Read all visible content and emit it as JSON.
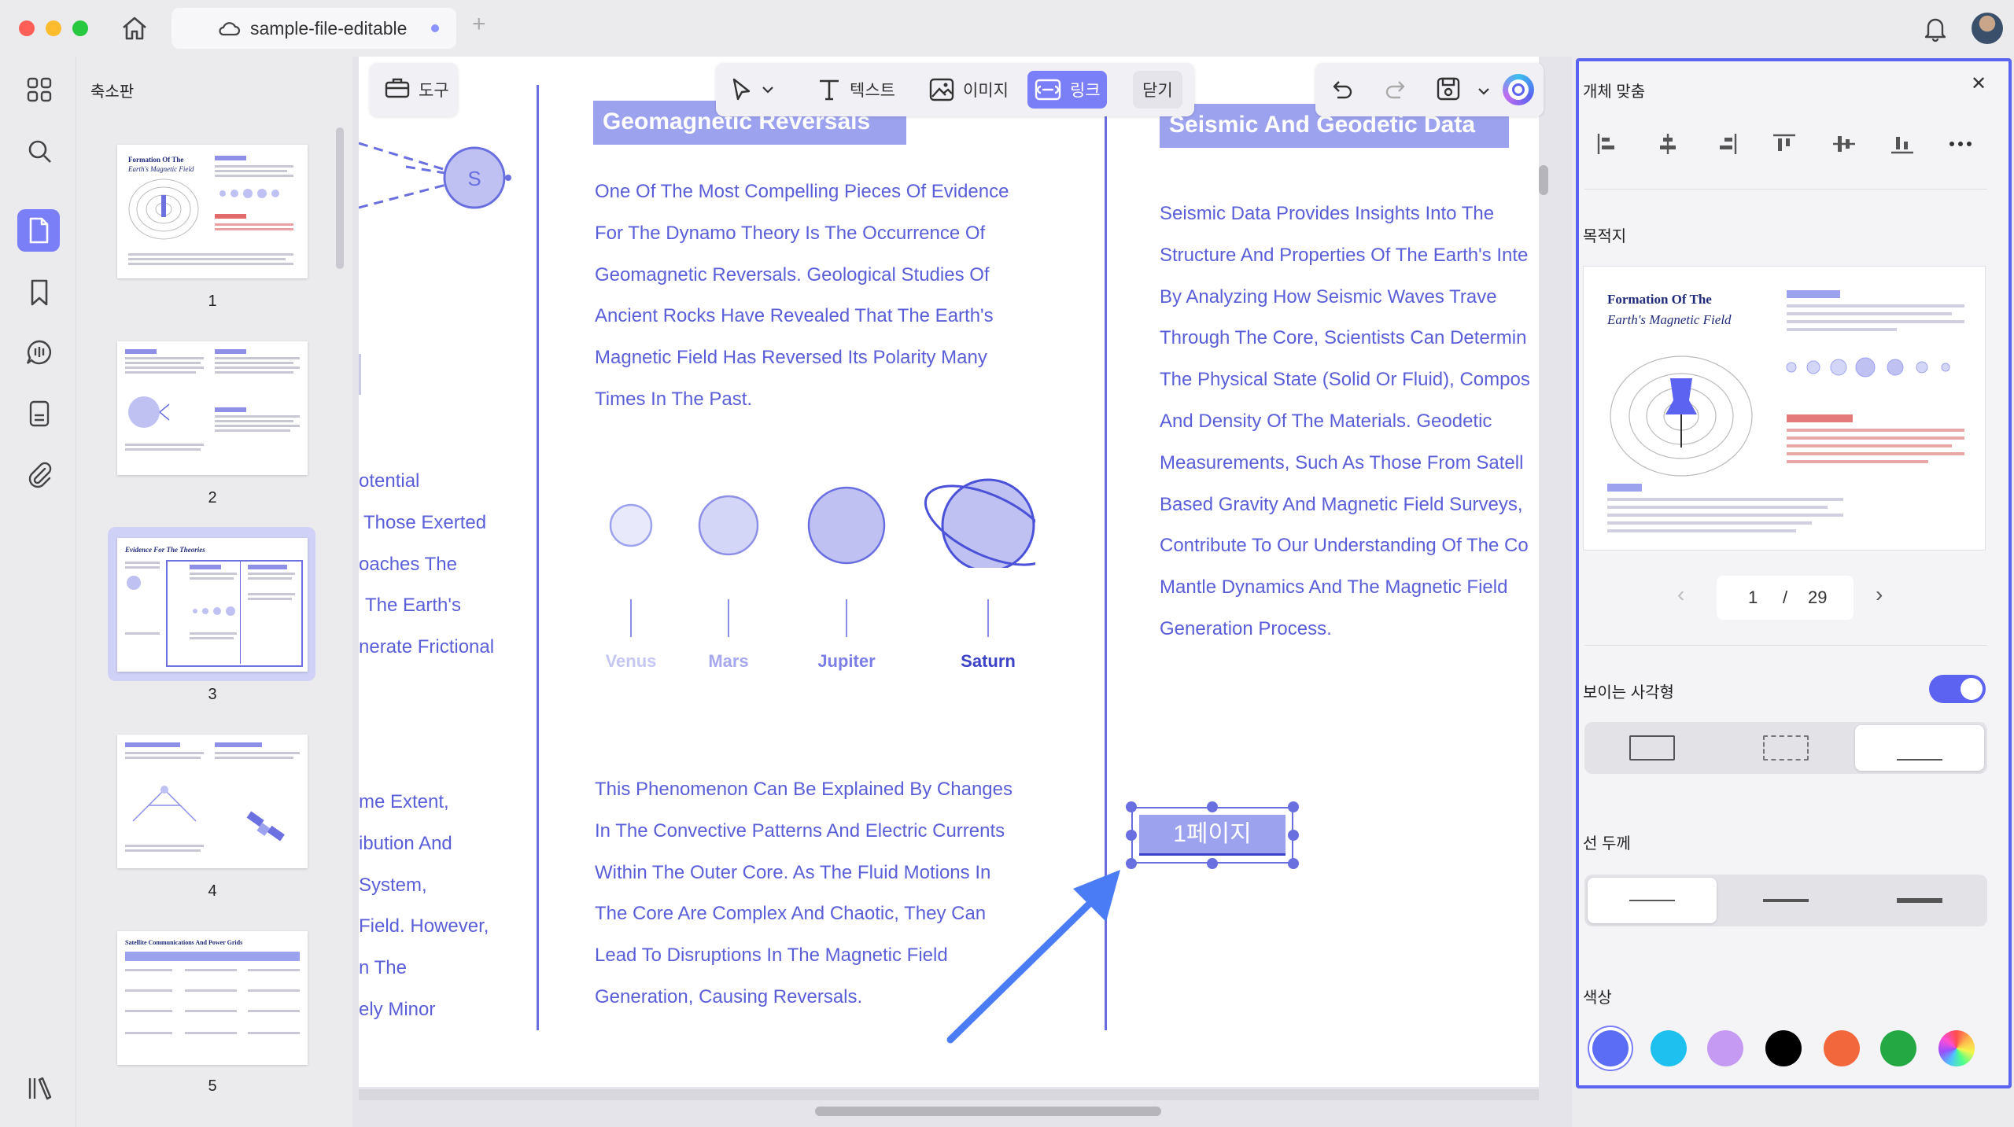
{
  "window": {
    "tab_title": "sample-file-editable",
    "tab_unsaved": true,
    "new_tab": "+"
  },
  "thumbnails": {
    "title": "축소판",
    "pages": [
      "1",
      "2",
      "3",
      "4",
      "5"
    ],
    "selected_page": "3",
    "thumb_titles": {
      "p1_line1": "Formation Of The",
      "p1_line2": "Earth's Magnetic Field",
      "p3_title": "Evidence For The Theories",
      "p5_title": "Satellite Communications And Power Grids"
    }
  },
  "toolbar": {
    "tools": "도구",
    "text": "텍스트",
    "image": "이미지",
    "link": "링크",
    "close": "닫기"
  },
  "document": {
    "left_column": [
      "otential",
      "Those Exerted",
      "oaches The",
      "The Earth's",
      "nerate Frictional",
      "me Extent,",
      "ibution And",
      "System,",
      "Field. However,",
      "n The",
      "ely Minor"
    ],
    "middle_heading": "Geomagnetic Reversals",
    "middle_para1": [
      "One Of The Most Compelling Pieces Of Evidence",
      "For The Dynamo Theory Is The Occurrence Of",
      "Geomagnetic Reversals. Geological Studies Of",
      "Ancient Rocks Have Revealed That The Earth's",
      "Magnetic Field Has Reversed Its Polarity Many",
      "Times In The Past."
    ],
    "planets": [
      "Venus",
      "Mars",
      "Jupiter",
      "Saturn"
    ],
    "middle_para2": [
      "This Phenomenon Can Be Explained By Changes",
      "In The Convective Patterns And Electric Currents",
      "Within The Outer Core. As The Fluid Motions In",
      "The Core Are Complex And Chaotic, They Can",
      "Lead To Disruptions In The Magnetic Field",
      "Generation, Causing Reversals."
    ],
    "right_heading": "Seismic And Geodetic Data",
    "right_para": [
      "Seismic Data Provides Insights Into The",
      "Structure And Properties Of The Earth's Inte",
      "By Analyzing How Seismic Waves Trave",
      "Through The Core, Scientists Can Determin",
      "The Physical State (Solid Or Fluid), Compos",
      "And Density Of The Materials. Geodetic",
      "Measurements, Such As Those From Satell",
      "Based Gravity And Magnetic Field Surveys,",
      "Contribute To Our Understanding Of The Co",
      "Mantle Dynamics And The Magnetic Field",
      "Generation Process."
    ],
    "link_box_label": "1페이지"
  },
  "properties": {
    "align_title": "개체 맞춤",
    "destination_title": "목적지",
    "preview_title_line1": "Formation Of The",
    "preview_title_line2": "Earth's Magnetic Field",
    "current_page": "1",
    "page_separator": "/",
    "total_pages": "29",
    "visible_rect_label": "보이는 사각형",
    "visible_rect_on": true,
    "line_width_label": "선 두께",
    "color_label": "색상",
    "colors": [
      "#5b6cf5",
      "#1ec0ef",
      "#c59af2",
      "#000000",
      "#f2673c",
      "#23a843",
      "rainbow"
    ],
    "selected_color": "#5b6cf5"
  }
}
